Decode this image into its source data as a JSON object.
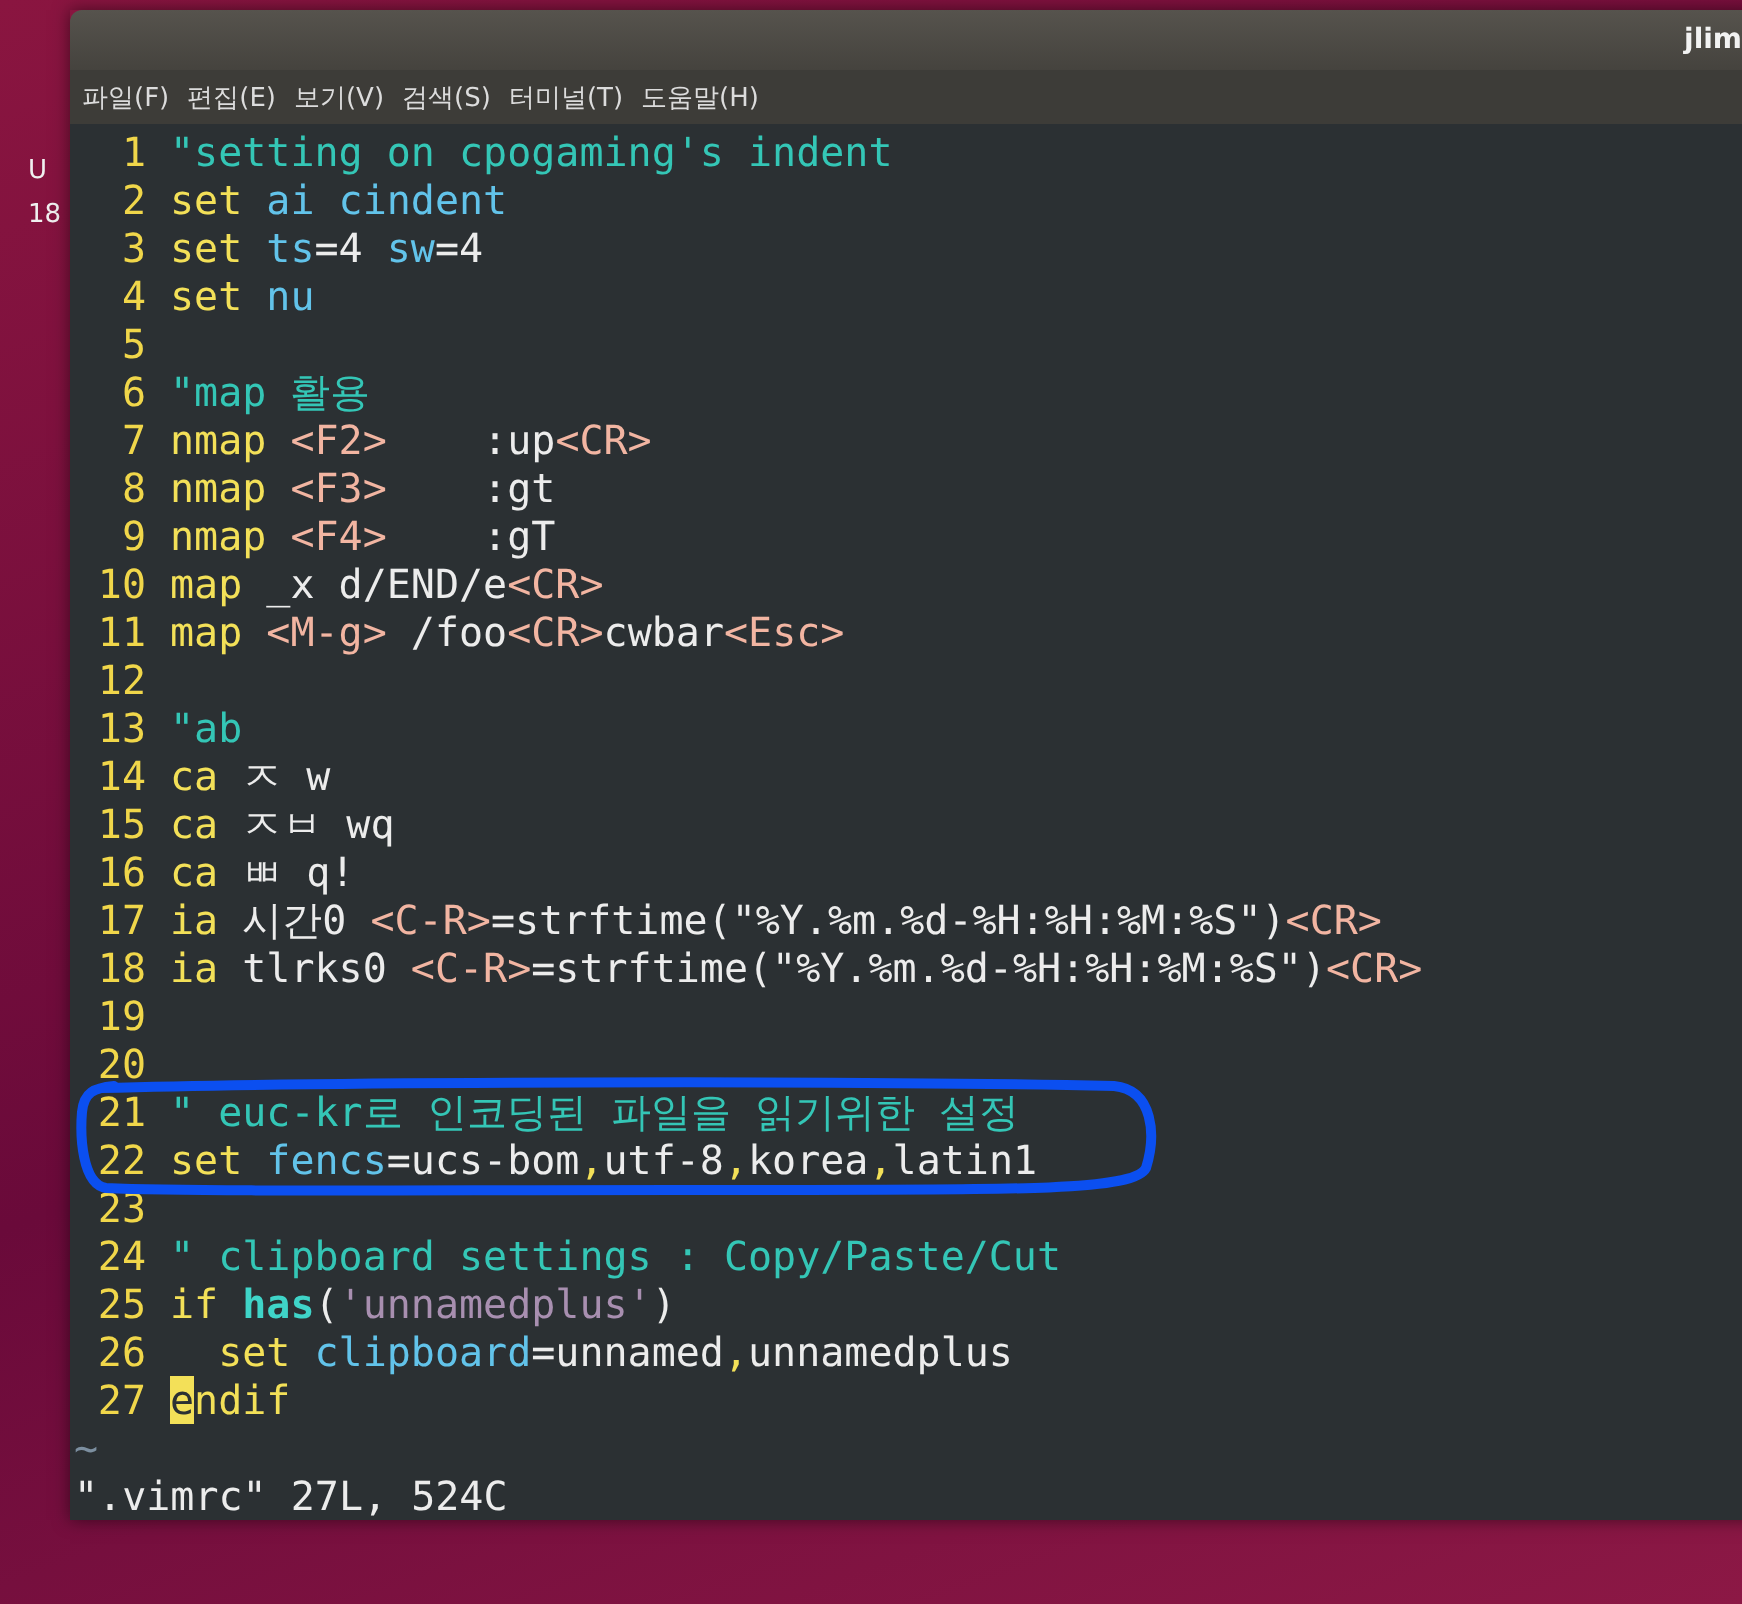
{
  "desktop_labels": [
    "U",
    "18"
  ],
  "window": {
    "title": "jlim"
  },
  "menu": [
    "파일(F)",
    "편집(E)",
    "보기(V)",
    "검색(S)",
    "터미널(T)",
    "도움말(H)"
  ],
  "lines": [
    {
      "number": "1",
      "tokens": [
        {
          "kind": "comment",
          "text": "\"setting on cpogaming's indent"
        }
      ]
    },
    {
      "number": "2",
      "tokens": [
        {
          "kind": "keyword",
          "text": "set"
        },
        {
          "kind": "option",
          "text": " ai cindent"
        }
      ]
    },
    {
      "number": "3",
      "tokens": [
        {
          "kind": "keyword",
          "text": "set"
        },
        {
          "kind": "option",
          "text": " ts"
        },
        {
          "kind": "plain",
          "text": "=4"
        },
        {
          "kind": "option",
          "text": " sw"
        },
        {
          "kind": "plain",
          "text": "=4"
        }
      ]
    },
    {
      "number": "4",
      "tokens": [
        {
          "kind": "keyword",
          "text": "set"
        },
        {
          "kind": "option",
          "text": " nu"
        }
      ]
    },
    {
      "number": "5"
    },
    {
      "number": "6",
      "tokens": [
        {
          "kind": "comment",
          "text": "\"map 활용"
        }
      ]
    },
    {
      "number": "7",
      "tokens": [
        {
          "kind": "keyword",
          "text": "nmap "
        },
        {
          "kind": "special",
          "text": "<F2>"
        },
        {
          "kind": "plain",
          "text": "    :up"
        },
        {
          "kind": "special",
          "text": "<CR>"
        }
      ]
    },
    {
      "number": "8",
      "tokens": [
        {
          "kind": "keyword",
          "text": "nmap "
        },
        {
          "kind": "special",
          "text": "<F3>"
        },
        {
          "kind": "plain",
          "text": "    :gt"
        }
      ]
    },
    {
      "number": "9",
      "tokens": [
        {
          "kind": "keyword",
          "text": "nmap "
        },
        {
          "kind": "special",
          "text": "<F4>"
        },
        {
          "kind": "plain",
          "text": "    :gT"
        }
      ]
    },
    {
      "number": "10",
      "tokens": [
        {
          "kind": "keyword",
          "text": "map "
        },
        {
          "kind": "plain",
          "text": "_x d/END/e"
        },
        {
          "kind": "special",
          "text": "<CR>"
        }
      ]
    },
    {
      "number": "11",
      "tokens": [
        {
          "kind": "keyword",
          "text": "map "
        },
        {
          "kind": "special",
          "text": "<M-g>"
        },
        {
          "kind": "plain",
          "text": " /foo"
        },
        {
          "kind": "special",
          "text": "<CR>"
        },
        {
          "kind": "plain",
          "text": "cwbar"
        },
        {
          "kind": "special",
          "text": "<Esc>"
        }
      ]
    },
    {
      "number": "12"
    },
    {
      "number": "13",
      "tokens": [
        {
          "kind": "comment",
          "text": "\"ab"
        }
      ]
    },
    {
      "number": "14",
      "tokens": [
        {
          "kind": "keyword",
          "text": "ca "
        },
        {
          "kind": "plain",
          "text": "ㅈ w"
        }
      ]
    },
    {
      "number": "15",
      "tokens": [
        {
          "kind": "keyword",
          "text": "ca "
        },
        {
          "kind": "plain",
          "text": "ㅈㅂ wq"
        }
      ]
    },
    {
      "number": "16",
      "tokens": [
        {
          "kind": "keyword",
          "text": "ca "
        },
        {
          "kind": "plain",
          "text": "ㅃ q!"
        }
      ]
    },
    {
      "number": "17",
      "tokens": [
        {
          "kind": "keyword",
          "text": "ia "
        },
        {
          "kind": "plain",
          "text": "시간0 "
        },
        {
          "kind": "special",
          "text": "<C-R>"
        },
        {
          "kind": "plain",
          "text": "=strftime(\"%Y.%m.%d-%H:%H:%M:%S\")"
        },
        {
          "kind": "special",
          "text": "<CR>"
        }
      ]
    },
    {
      "number": "18",
      "tokens": [
        {
          "kind": "keyword",
          "text": "ia "
        },
        {
          "kind": "plain",
          "text": "tlrks0 "
        },
        {
          "kind": "special",
          "text": "<C-R>"
        },
        {
          "kind": "plain",
          "text": "=strftime(\"%Y.%m.%d-%H:%H:%M:%S\")"
        },
        {
          "kind": "special",
          "text": "<CR>"
        }
      ]
    },
    {
      "number": "19"
    },
    {
      "number": "20"
    },
    {
      "number": "21",
      "tokens": [
        {
          "kind": "comment",
          "text": "\" euc-kr로 인코딩된 파일을 읽기위한 설정"
        }
      ]
    },
    {
      "number": "22",
      "tokens": [
        {
          "kind": "keyword",
          "text": "set"
        },
        {
          "kind": "option",
          "text": " fencs"
        },
        {
          "kind": "plain",
          "text": "=ucs-bom"
        },
        {
          "kind": "keyword",
          "text": ","
        },
        {
          "kind": "plain",
          "text": "utf-8"
        },
        {
          "kind": "keyword",
          "text": ","
        },
        {
          "kind": "plain",
          "text": "korea"
        },
        {
          "kind": "keyword",
          "text": ","
        },
        {
          "kind": "plain",
          "text": "latin1"
        }
      ]
    },
    {
      "number": "23"
    },
    {
      "number": "24",
      "tokens": [
        {
          "kind": "comment",
          "text": "\" clipboard settings : Copy/Paste/Cut"
        }
      ]
    },
    {
      "number": "25",
      "tokens": [
        {
          "kind": "keyword",
          "text": "if "
        },
        {
          "kind": "function",
          "text": "has"
        },
        {
          "kind": "plain",
          "text": "("
        },
        {
          "kind": "string",
          "text": "'unnamedplus'"
        },
        {
          "kind": "plain",
          "text": ")"
        }
      ]
    },
    {
      "number": "26",
      "tokens": [
        {
          "kind": "keyword",
          "text": "  set"
        },
        {
          "kind": "option",
          "text": " clipboard"
        },
        {
          "kind": "plain",
          "text": "=unnamed"
        },
        {
          "kind": "keyword",
          "text": ","
        },
        {
          "kind": "plain",
          "text": "unnamedplus"
        }
      ]
    },
    {
      "number": "27",
      "tokens": [
        {
          "kind": "cursor",
          "text": "e"
        },
        {
          "kind": "keyword",
          "text": "ndif"
        }
      ]
    }
  ],
  "empty_markers": [
    "~"
  ],
  "status_line": "\".vimrc\" 27L, 524C"
}
